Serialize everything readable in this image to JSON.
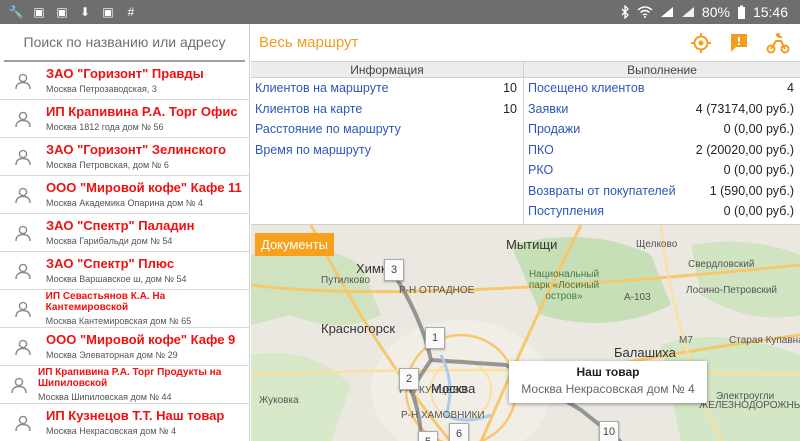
{
  "status": {
    "battery": "80%",
    "time": "15:46",
    "left_icons": [
      "wrench-icon",
      "picture-icon",
      "picture-icon",
      "download-icon",
      "picture-icon",
      "hash-icon"
    ],
    "left_glyphs": [
      "🔧",
      "▣",
      "▣",
      "⬇",
      "▣",
      "#"
    ]
  },
  "search": {
    "placeholder": "Поиск по названию или адресу"
  },
  "clients": [
    {
      "name": "ЗАО \"Горизонт\" Правды",
      "address": "Москва Петрозаводская, 3",
      "small": false
    },
    {
      "name": "ИП Крапивина Р.А. Торг Офис",
      "address": "Москва 1812 года дом № 56",
      "small": false
    },
    {
      "name": "ЗАО \"Горизонт\" Зелинского",
      "address": "Москва Петровская, дом № 6",
      "small": false
    },
    {
      "name": "ООО \"Мировой кофе\" Кафе 11",
      "address": "Москва Академика Опарина дом № 4",
      "small": false
    },
    {
      "name": "ЗАО \"Спектр\" Паладин",
      "address": "Москва Гарибальди дом № 54",
      "small": false
    },
    {
      "name": "ЗАО \"Спектр\" Плюс",
      "address": "Москва Варшавское ш, дом № 54",
      "small": false
    },
    {
      "name": "ИП Севастьянов К.А. На Кантемировской",
      "address": "Москва Кантемировская дом № 65",
      "small": true
    },
    {
      "name": "ООО \"Мировой кофе\" Кафе 9",
      "address": "Москва Элеваторная дом № 29",
      "small": false
    },
    {
      "name": "ИП Крапивина Р.А. Торг Продукты на Шипиловской",
      "address": "Москва Шипиловская дом № 44",
      "small": true
    },
    {
      "name": "ИП Кузнецов Т.Т. Наш товар",
      "address": "Москва Некрасовская дом № 4",
      "small": false
    }
  ],
  "route": {
    "title": "Весь маршрут"
  },
  "info": {
    "header": "Информация",
    "rows": [
      {
        "label": "Клиентов на маршруте",
        "value": "10"
      },
      {
        "label": "Клиентов на карте",
        "value": "10"
      },
      {
        "label": "Расстояние по маршруту",
        "value": ""
      },
      {
        "label": "Время по маршруту",
        "value": ""
      }
    ]
  },
  "execution": {
    "header": "Выполнение",
    "rows": [
      {
        "label": "Посещено клиентов",
        "value": "4"
      },
      {
        "label": "Заявки",
        "value": "4 (73174,00 руб.)"
      },
      {
        "label": "Продажи",
        "value": "0 (0,00 руб.)"
      },
      {
        "label": "ПКО",
        "value": "2 (20020,00 руб.)"
      },
      {
        "label": "РКО",
        "value": "0 (0,00 руб.)"
      },
      {
        "label": "Возвраты от покупателей",
        "value": "1 (590,00 руб.)"
      },
      {
        "label": "Поступления",
        "value": "0 (0,00 руб.)"
      }
    ]
  },
  "map": {
    "documents_button": "Документы",
    "labels": [
      {
        "text": "Мытищи",
        "cls": "big"
      },
      {
        "text": "Химки",
        "cls": "big"
      },
      {
        "text": "Щелково",
        "cls": ""
      },
      {
        "text": "Свердловский",
        "cls": ""
      },
      {
        "text": "Путилково",
        "cls": ""
      },
      {
        "text": "Р-Н ОТРАДНОЕ",
        "cls": ""
      },
      {
        "text": "Национальный парк «Лосиный остров»",
        "cls": "green"
      },
      {
        "text": "A-103",
        "cls": ""
      },
      {
        "text": "Лосино-Петровский",
        "cls": ""
      },
      {
        "text": "Красногорск",
        "cls": "big"
      },
      {
        "text": "Р-Н КУНЦЕВО",
        "cls": ""
      },
      {
        "text": "Москва",
        "cls": "big"
      },
      {
        "text": "Балашиха",
        "cls": "big"
      },
      {
        "text": "Старая Купавна",
        "cls": ""
      },
      {
        "text": "Электроугли",
        "cls": ""
      },
      {
        "text": "Жуковка",
        "cls": ""
      },
      {
        "text": "Р-Н ХАМОВНИКИ",
        "cls": ""
      },
      {
        "text": "ЖЕЛЕЗНОДОРОЖНЫЙ",
        "cls": ""
      },
      {
        "text": "M7",
        "cls": ""
      }
    ],
    "markers": [
      "3",
      "1",
      "2",
      "6",
      "5",
      "10"
    ],
    "popup": {
      "title": "Наш товар",
      "subtitle": "Москва Некрасовская дом № 4"
    }
  }
}
